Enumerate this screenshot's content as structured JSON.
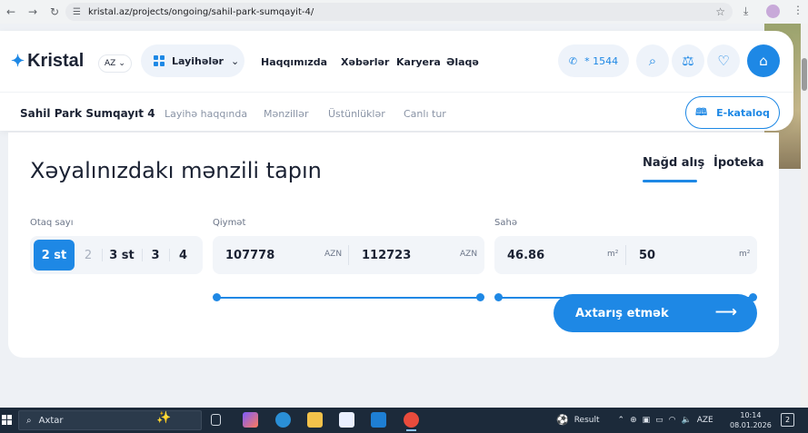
{
  "browser": {
    "url": "kristal.az/projects/ongoing/sahil-park-sumqayit-4/",
    "icons": [
      "back-icon",
      "forward-icon",
      "reload-icon",
      "site-settings-icon",
      "bookmark-star-icon",
      "download-icon",
      "extension-icon",
      "more-icon"
    ]
  },
  "header": {
    "logo": "Kristal",
    "lang": "AZ",
    "projects": "Layihələr",
    "nav": [
      "Haqqımızda",
      "Xəbərlər",
      "Karyera",
      "Əlaqə"
    ],
    "phone": "* 1544"
  },
  "subnav": {
    "title": "Sahil Park Sumqayıt 4",
    "links": [
      "Layihə haqqında",
      "Mənzillər",
      "Üstünlüklər",
      "Canlı tur"
    ],
    "catalog": "E-kataloq"
  },
  "search": {
    "title": "Xəyalınızdakı mənzili tapın",
    "tabs": [
      {
        "label": "Nağd alış",
        "active": true
      },
      {
        "label": "İpoteka",
        "active": false
      }
    ],
    "rooms": {
      "label": "Otaq sayı",
      "options": [
        {
          "label": "2 st",
          "state": "active"
        },
        {
          "label": "2",
          "state": "disabled"
        },
        {
          "label": "3 st",
          "state": "normal"
        },
        {
          "label": "3",
          "state": "normal"
        },
        {
          "label": "4",
          "state": "normal"
        }
      ]
    },
    "price": {
      "label": "Qiymət",
      "min": "107778",
      "max": "112723",
      "unit": "AZN"
    },
    "area": {
      "label": "Sahə",
      "min": "46.86",
      "max": "50",
      "unit": "m²"
    },
    "button": "Axtarış etmək"
  },
  "taskbar": {
    "search": "Axtar",
    "result_label": "Result",
    "lang": "AZE",
    "time": "10:14",
    "date": "08.01.2026",
    "notifications": "2"
  },
  "colors": {
    "accent": "#1e88e5",
    "text": "#1b2233",
    "muted": "#8a94a6"
  }
}
